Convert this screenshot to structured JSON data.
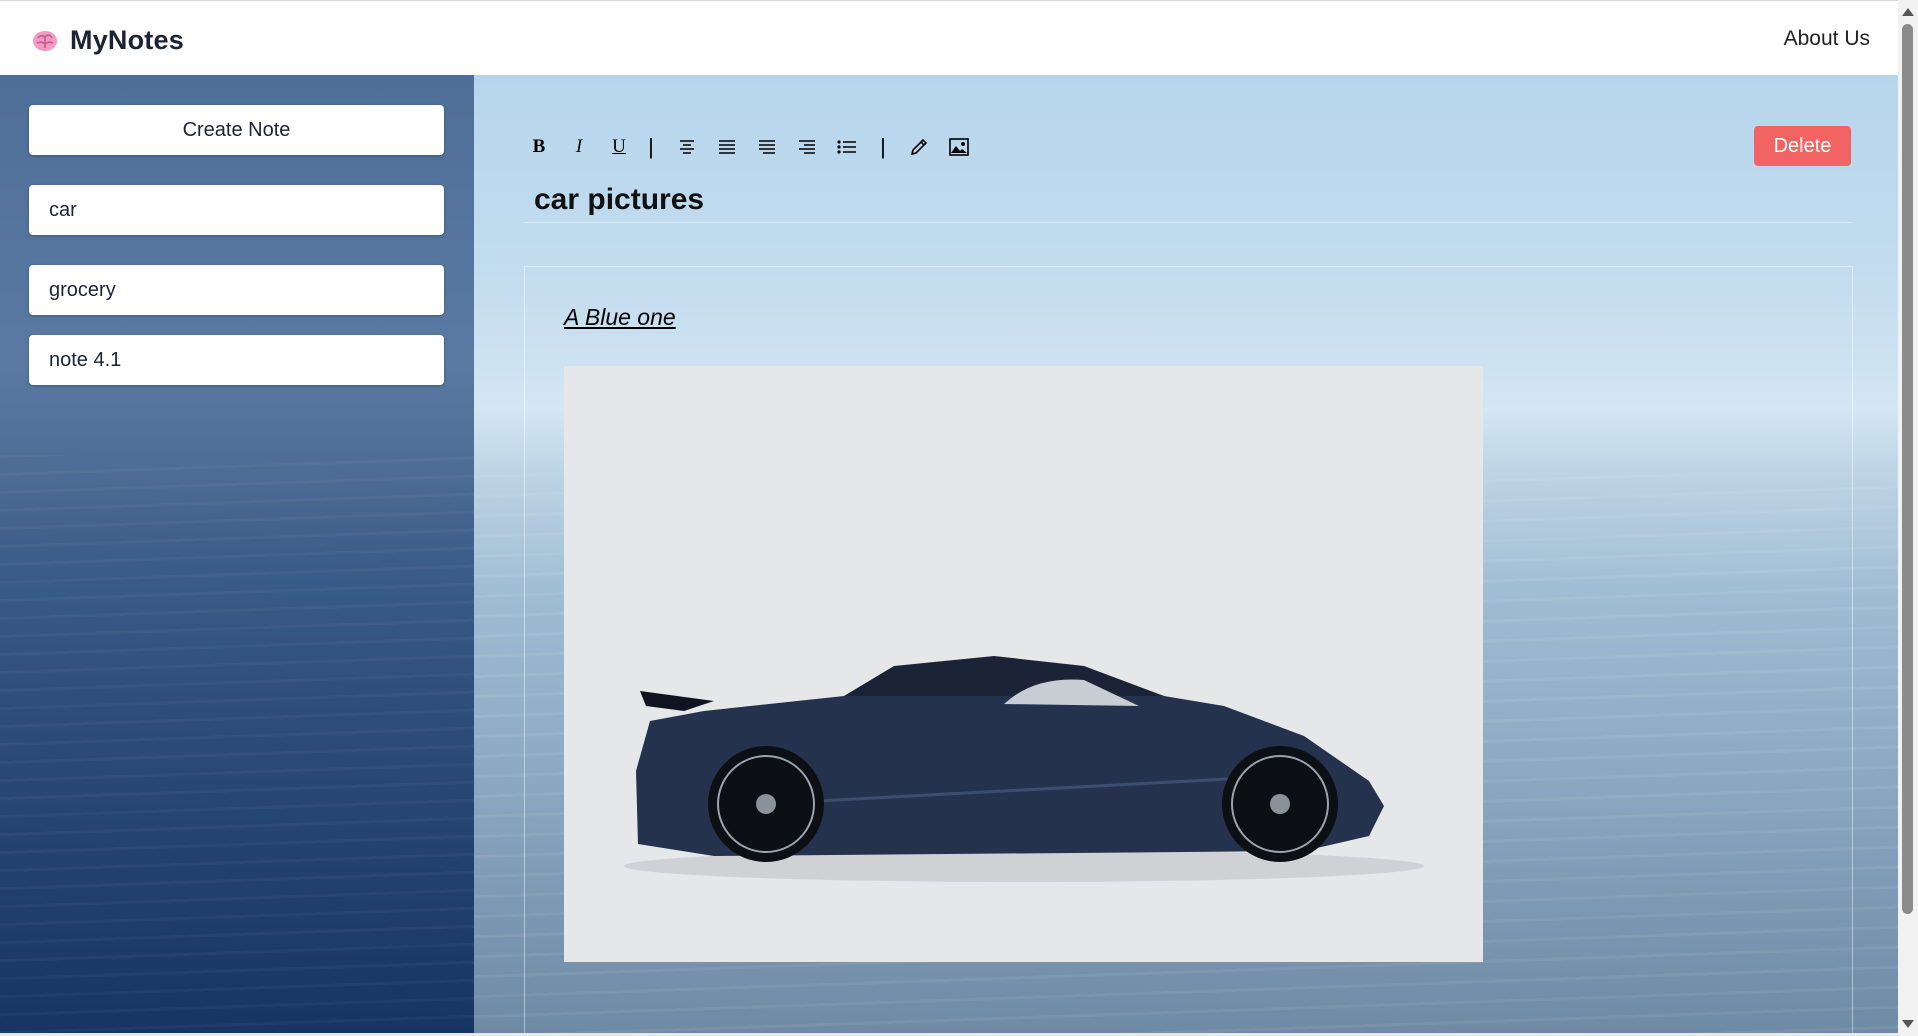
{
  "header": {
    "app_title": "MyNotes",
    "logo_icon": "brain-icon",
    "about_label": "About Us"
  },
  "sidebar": {
    "create_label": "Create Note",
    "notes": [
      "car",
      "grocery",
      "note 4.1"
    ]
  },
  "toolbar": {
    "bold": "B",
    "italic": "I",
    "underline": "U",
    "separator": "|",
    "icons": [
      "align-center-icon",
      "align-left-icon",
      "align-justify-icon",
      "align-right-icon",
      "bullet-list-icon",
      "pen-icon",
      "image-icon"
    ]
  },
  "note": {
    "title": "car pictures",
    "body_text": "A Blue one",
    "image_icon": "car-image"
  },
  "actions": {
    "delete_label": "Delete"
  },
  "colors": {
    "delete": "#f26464",
    "sidebar_top": "#4e6f97",
    "sidebar_bottom": "#173563",
    "brand": "#1b2433"
  }
}
